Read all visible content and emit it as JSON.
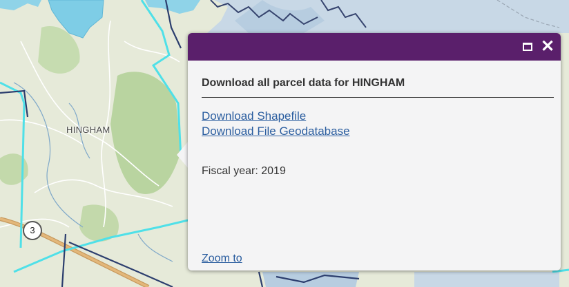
{
  "map": {
    "town_label": "HINGHAM",
    "route_number": "3"
  },
  "popup": {
    "header_color": "#5a1f6b",
    "maximize_icon": "maximize-icon",
    "close_icon": "close-icon",
    "close_glyph": "✕",
    "title": "Download all parcel data for HINGHAM",
    "links": [
      "Download Shapefile",
      "Download File Geodatabase"
    ],
    "fiscal_year_text": "Fiscal year: 2019",
    "zoom_label": "Zoom to"
  }
}
